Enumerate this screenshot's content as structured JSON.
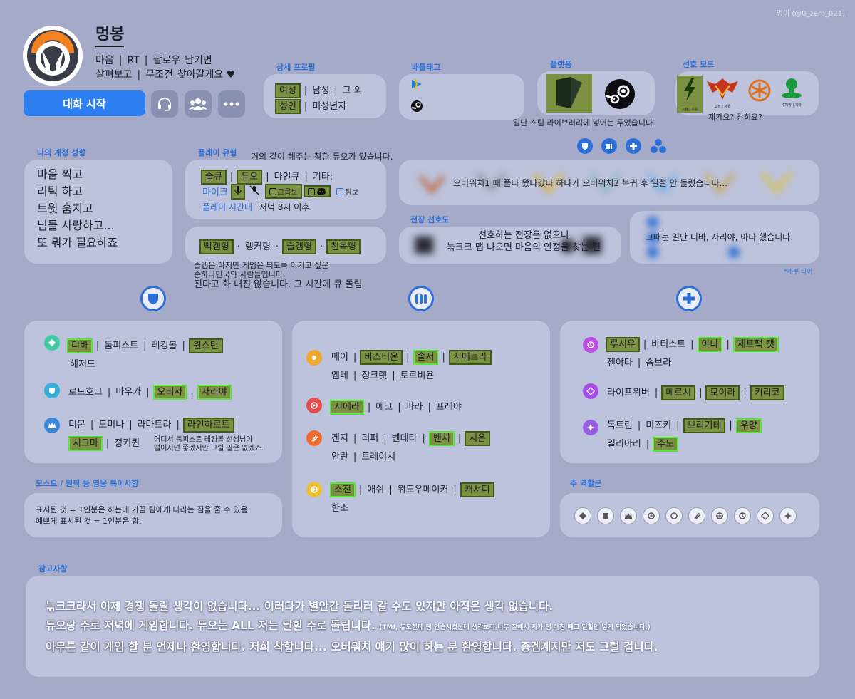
{
  "watermark": "멍이 (@0_zero_021)",
  "profile": {
    "name": "멍봉",
    "bio_line1": [
      "마음",
      "RT",
      "팔로우",
      "남기면"
    ],
    "bio_line2": [
      "살펴보고",
      "무조건",
      "찾아갈게요 ♥"
    ],
    "chat_button": "대화 시작"
  },
  "detail_profile": {
    "title": "상세 프로필",
    "gender": [
      "여성",
      "남성",
      "그 외"
    ],
    "age": [
      "성인",
      "미성년자"
    ]
  },
  "battletag": {
    "title": "배틀태그"
  },
  "platform": {
    "title": "플랫폼",
    "note": "일단 스팀 라이브러리에 넣어는 두었습니다."
  },
  "mode": {
    "title": "선호 모드",
    "labels": [
      "고정 | 자유",
      "고정 | 자유",
      "수예양 | 기타"
    ],
    "note": "제가요? 감히요?"
  },
  "account": {
    "title": "나의 계정 성향",
    "lines": [
      "마음 찍고",
      "리틱 하고",
      "트윗 훔치고",
      "님들 사랑하고...",
      "또 뭐가 필요하죠"
    ]
  },
  "play_type": {
    "title": "플레이 유형",
    "queue": [
      "솔큐",
      "듀오",
      "다인큐",
      "기타:"
    ],
    "voice": [
      "마이크",
      "그룹보",
      "팀보"
    ],
    "time_label": "플레이 시간대",
    "time_value": "저녁 8시 이후",
    "duo_note_1": "거의 같이 해주는 착한 듀오가 있습니다.",
    "duo_note_2": "함께해요.",
    "styles": [
      "빡겜형",
      "랭커형",
      "즐겜형",
      "친목형"
    ],
    "style_note_1": "즐겜은 하지만 게임은 되도록 이기고 싶은",
    "style_note_2": "송하나민국의 사람들입니다.",
    "style_note_3": "진다고 화 내진 않습니다. 그 시간에 큐 돌림"
  },
  "tier": {
    "note": "오버워치1 때 플다 왔다갔다 하다가 오버워치2 복귀 후 일절 안 돌렸습니다...",
    "sub_note": "그때는 일단 디바, 자리야, 아나 했습니다.",
    "detail_label": "*세부 티어"
  },
  "map_pref": {
    "title": "전장 선호도",
    "note_1": "선호하는 전장은 없으나",
    "note_2": "늒크크 맵 나오면 마음의 안정을 찾는 편"
  },
  "tank": {
    "main": [
      [
        "디바",
        true
      ],
      [
        "둠피스트",
        false
      ],
      [
        "레킹볼",
        false
      ],
      [
        "윈스턴",
        true
      ]
    ],
    "main_wrap": "해저드",
    "bruiser": [
      [
        "로드호그",
        false
      ],
      [
        "마우가",
        false
      ],
      [
        "오리사",
        true
      ],
      [
        "자리야",
        true
      ]
    ],
    "anchor": [
      [
        "디몬",
        false
      ],
      [
        "도미나",
        false
      ],
      [
        "라마트라",
        false
      ],
      [
        "라인하르트",
        true
      ]
    ],
    "anchor_wrap": [
      [
        "시그마",
        true
      ],
      [
        "정커퀸",
        false
      ]
    ],
    "anchor_note_1": "어디서 둠피스트 레킹볼 선생님이",
    "anchor_note_2": "떨어지면 좋겠지만 그럴 일은 없겠죠."
  },
  "damage": {
    "g1": [
      [
        "메이",
        false
      ],
      [
        "바스티온",
        true
      ],
      [
        "솔저",
        true
      ],
      [
        "시메트라",
        true
      ]
    ],
    "g1_wrap": [
      "엠레",
      "정크렛",
      "토르비욘"
    ],
    "g2": [
      [
        "시에라",
        true
      ],
      [
        "에코",
        false
      ],
      [
        "파라",
        false
      ],
      [
        "프레야",
        false
      ]
    ],
    "g3": [
      [
        "겐지",
        false
      ],
      [
        "리퍼",
        false
      ],
      [
        "벤데타",
        false
      ],
      [
        "벤처",
        true
      ],
      [
        "시온",
        true
      ]
    ],
    "g3_wrap": [
      "안란",
      "트레이서"
    ],
    "g4": [
      [
        "소전",
        true
      ],
      [
        "애쉬",
        false
      ],
      [
        "위도우메이커",
        false
      ],
      [
        "캐서디",
        true
      ]
    ],
    "g4_wrap": "한조"
  },
  "support": {
    "g1": [
      [
        "루시우",
        false
      ],
      [
        "바티스트",
        false
      ],
      [
        "아나",
        true
      ],
      [
        "제트팩 캣",
        true
      ]
    ],
    "g1_wrap": [
      "젠야타",
      "솜브라"
    ],
    "g2": [
      [
        "라이프위버",
        false
      ],
      [
        "메르시",
        true
      ],
      [
        "모이라",
        true
      ],
      [
        "키리코",
        true
      ]
    ],
    "g3": [
      [
        "독트린",
        false
      ],
      [
        "미즈키",
        false
      ],
      [
        "브리기테",
        true
      ],
      [
        "우양",
        true
      ]
    ],
    "g3_wrap": [
      [
        "일리아리",
        false
      ],
      [
        "주노",
        true
      ]
    ]
  },
  "most": {
    "title": "모스트 / 원픽 등 영웅 특이사항",
    "line1": "표시된 것 = 1인분은 하는데 가끔 팀에게 나라는 짐을 줄 수 있음.",
    "line2": "예쁘게 표시된 것 = 1인분은 함."
  },
  "main_role": {
    "title": "주 역할군"
  },
  "reference": {
    "title": "참고사항",
    "line1": "늒크크라서 이제 경쟁 돌릴 생각이 없습니다... 이러다가 별안간 돌리러 갈 수도 있지만 아직은 생각 없습니다.",
    "line2a": "듀오랑 주로 저녁에 게임합니다. 듀오는 ALL 저는 딜힐 주로 돌립니다.",
    "line2b": "(TMI, 듀오한테 탱 연습시켰는데 생각보다 너무 잘해서 제가 탱 매칭 빼고 딜힐만 넣게 되었습니다.)",
    "line3": "아무튼 같이 게임 할 분 언제나 환영합니다. 저희 착합니다... 오버워치 얘기 많이 하는 분 환영합니다. 종겜계지만 저도 그럴 겁니다."
  },
  "colors": {
    "background": "#a4aac7",
    "panel": "#bdc3dc",
    "accent": "#2d6fd6",
    "highlight": "#7d9142",
    "highlight_border": "#58e83a"
  }
}
